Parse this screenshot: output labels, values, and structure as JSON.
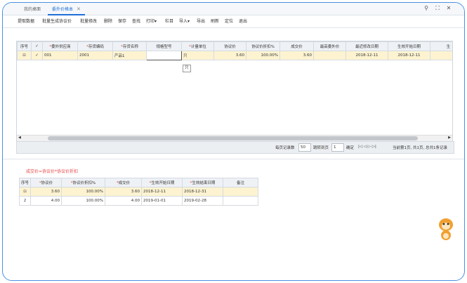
{
  "tabs": [
    {
      "label": "我的桌面"
    },
    {
      "label": "委外价格本"
    }
  ],
  "toolbar": [
    "提取数据",
    "批量生成协议价",
    "批量修改",
    "删除",
    "保存",
    "查找",
    "打印",
    "栏目",
    "导入",
    "导出",
    "刷新",
    "定位",
    "退出"
  ],
  "grid": {
    "columns": [
      "序号",
      "",
      "委外供应商",
      "存货编码",
      "存货名称",
      "规格型号",
      "计量单位",
      "协议价",
      "协议价折扣%",
      "成交价",
      "最高委外价",
      "最近修改日期",
      "生效开始日期",
      "生"
    ],
    "rows": [
      {
        "seq": "",
        "checked": "✓",
        "supplier": "001",
        "code": "2001",
        "name": "产品1",
        "spec": "",
        "unit": "只",
        "price": "3.60",
        "discount": "100.00%",
        "deal": "3.60",
        "max": "",
        "modified": "2018-12-11",
        "start": "2018-12-11",
        "more": ""
      }
    ],
    "tooltip": "只"
  },
  "pager": {
    "per_page_label": "每页记录数",
    "per_page": "50",
    "goto_label": "跳转到页",
    "page": "1",
    "confirm": "确定",
    "nav": "|◁  ◁  ▷  ▷|",
    "status": "当前第1页, 共1页, 总共1条记录"
  },
  "subtitle": "成交价=协议价*协议价折扣",
  "grid2": {
    "columns": [
      "序号",
      "协议价",
      "协议价折扣%",
      "成交价",
      "生效开始日期",
      "生效结束日期",
      "备注"
    ],
    "rows": [
      {
        "seq": "",
        "price": "3.60",
        "discount": "100.00%",
        "deal": "3.60",
        "start": "2018-12-11",
        "end": "2018-12-31",
        "note": ""
      },
      {
        "seq": "2",
        "price": "4.00",
        "discount": "100.00%",
        "deal": "4.00",
        "start": "2019-01-01",
        "end": "2019-02-28",
        "note": ""
      }
    ]
  },
  "colors": {
    "accent": "#1e6fd9",
    "selected_row": "#fdf3d1",
    "required": "#e23b3b"
  }
}
